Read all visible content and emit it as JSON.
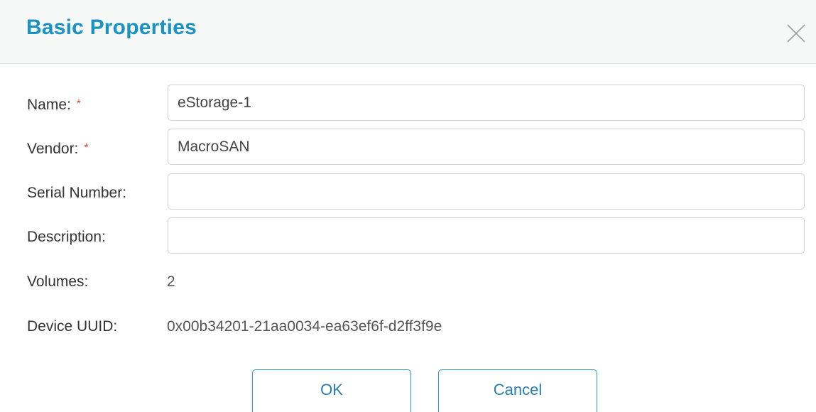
{
  "dialog": {
    "title": "Basic Properties",
    "close_icon": "close-icon"
  },
  "form": {
    "name": {
      "label": "Name:",
      "required_mark": "*",
      "value": "eStorage-1"
    },
    "vendor": {
      "label": "Vendor:",
      "required_mark": "*",
      "value": "MacroSAN"
    },
    "serial_number": {
      "label": "Serial Number:",
      "value": ""
    },
    "description": {
      "label": "Description:",
      "value": ""
    },
    "volumes": {
      "label": "Volumes:",
      "value": "2"
    },
    "device_uuid": {
      "label": "Device UUID:",
      "value": "0x00b34201-21aa0034-ea63ef6f-d2ff3f9e"
    }
  },
  "buttons": {
    "ok_label": "OK",
    "cancel_label": "Cancel"
  },
  "colors": {
    "title": "#1a93c4",
    "required": "#e0493c",
    "button_border": "#2a98c8",
    "header_background": "#f6f8f8"
  }
}
